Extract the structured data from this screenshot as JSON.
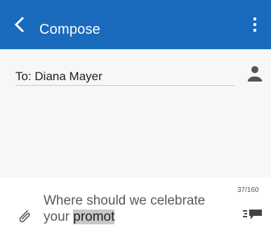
{
  "header": {
    "title": "Compose",
    "back_icon": "chevron-left-icon",
    "menu_icon": "more-vert-icon",
    "color": "#1a6bbd"
  },
  "recipient": {
    "value": "To: Diana Mayer",
    "contact_icon": "person-icon"
  },
  "composer": {
    "text_before": "Where should we celebrate your ",
    "text_highlighted": "promot",
    "char_count": "37/160",
    "attach_icon": "paperclip-icon",
    "send_icon": "send-message-icon"
  }
}
